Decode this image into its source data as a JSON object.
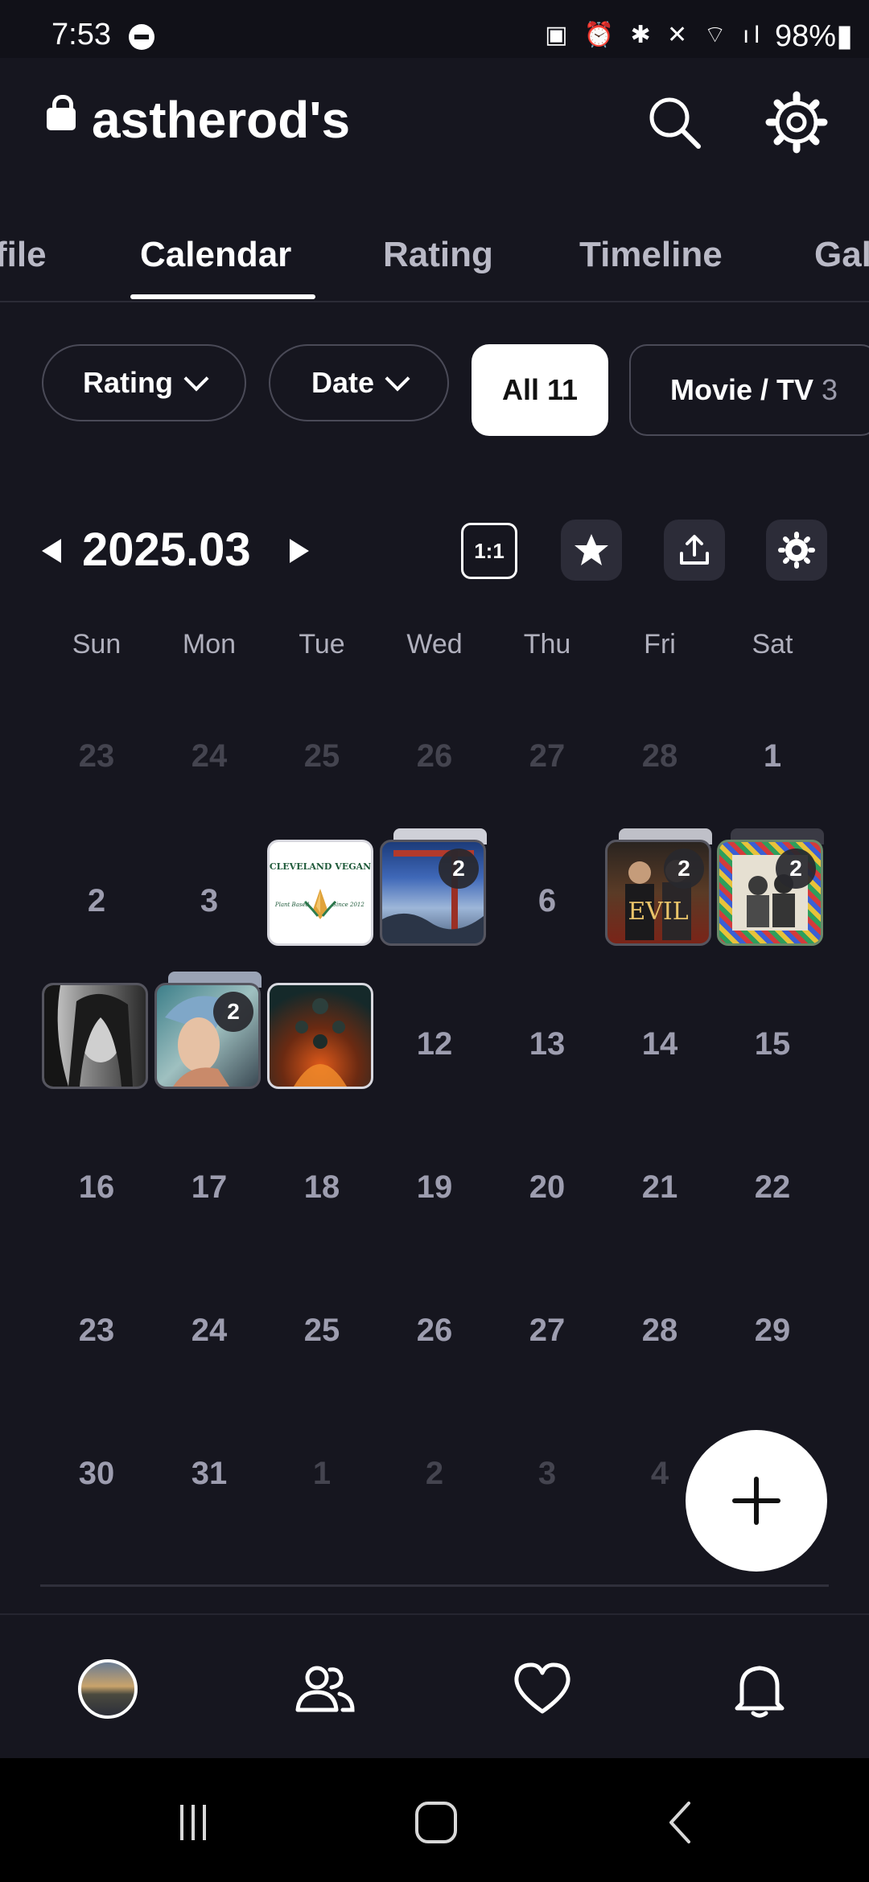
{
  "status_bar": {
    "time": "7:53",
    "indicators": "▣ ⏰ ✱ ✕ ⌔ ıl",
    "battery": "98%▮"
  },
  "header": {
    "title": "astherod's",
    "icons": [
      "lock-icon",
      "search-icon",
      "gear-icon"
    ]
  },
  "tabs": [
    {
      "label": "file"
    },
    {
      "label": "Calendar"
    },
    {
      "label": "Rating"
    },
    {
      "label": "Timeline"
    },
    {
      "label": "Gal"
    }
  ],
  "active_tab": "Calendar",
  "filters": {
    "rating": "Rating",
    "date": "Date",
    "all_label": "All",
    "all_count": "11",
    "movie_label": "Movie / TV",
    "movie_count": "3"
  },
  "calendar": {
    "month": "2025.03",
    "ratio_label": "1:1",
    "weekdays": [
      "Sun",
      "Mon",
      "Tue",
      "Wed",
      "Thu",
      "Fri",
      "Sat"
    ],
    "rows": [
      [
        "23",
        "24",
        "25",
        "26",
        "27",
        "28",
        "1"
      ],
      [
        "2",
        "3",
        "4",
        "5",
        "6",
        "7",
        "8"
      ],
      [
        "9",
        "10",
        "11",
        "12",
        "13",
        "14",
        "15"
      ],
      [
        "16",
        "17",
        "18",
        "19",
        "20",
        "21",
        "22"
      ],
      [
        "23",
        "24",
        "25",
        "26",
        "27",
        "28",
        "29"
      ],
      [
        "30",
        "31",
        "1",
        "2",
        "3",
        "4",
        ""
      ]
    ],
    "entries": [
      {
        "day": "4",
        "count": "",
        "title": "CLEVELAND VEGAN",
        "left_text": "Plant Based",
        "right_text": "Since 2012"
      },
      {
        "day": "5",
        "count": "2"
      },
      {
        "day": "7",
        "count": "2",
        "title": "EVIL"
      },
      {
        "day": "8",
        "count": "2"
      },
      {
        "day": "9",
        "count": ""
      },
      {
        "day": "10",
        "count": "2"
      },
      {
        "day": "11",
        "count": ""
      }
    ]
  },
  "colors": {
    "background": "#16161f",
    "text_dim": "#9d9daf",
    "chip_border": "#4a4a57"
  },
  "bottom_nav": {
    "items": [
      "profile-avatar",
      "friends-icon",
      "heart-icon",
      "bell-icon"
    ]
  },
  "system_nav": {
    "items": [
      "recent-apps",
      "home",
      "back"
    ]
  }
}
